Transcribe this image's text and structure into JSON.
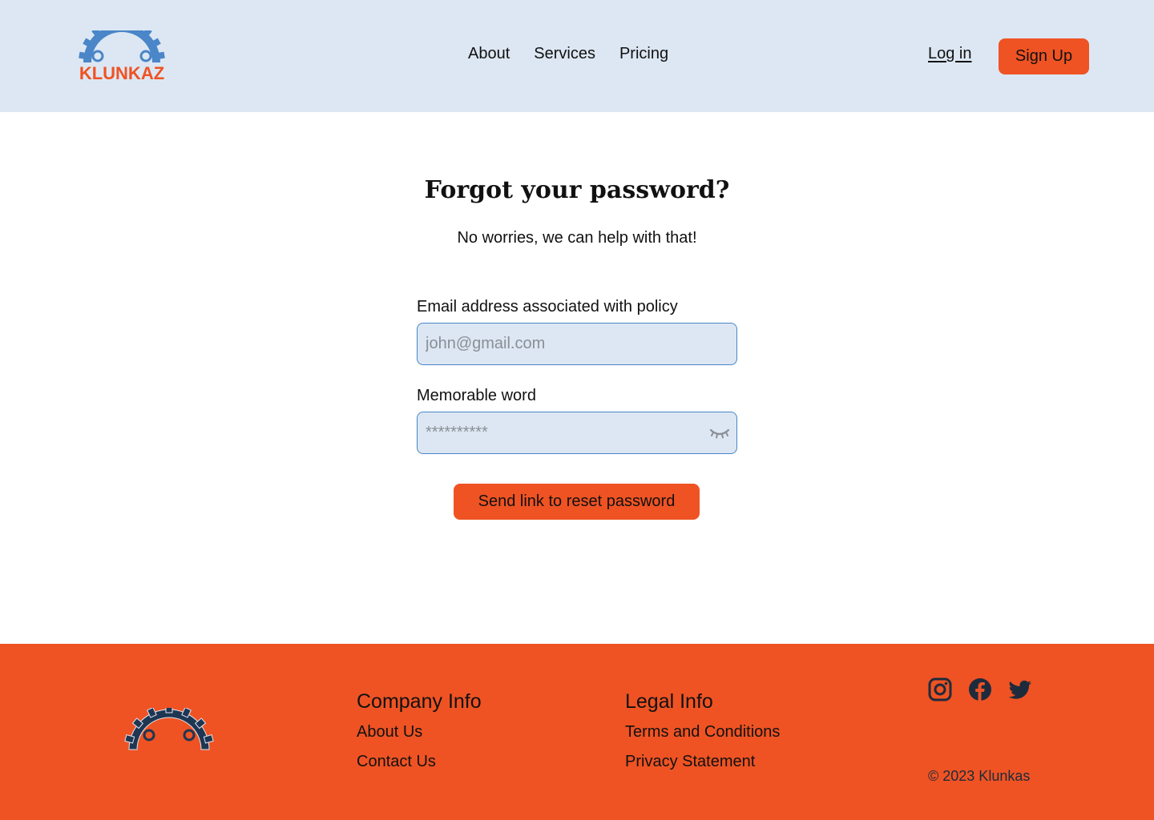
{
  "brand": {
    "logo_text": "KLUNKAZ",
    "accent_color": "#ef5323",
    "logo_gear_color": "#4a86c8",
    "header_bg": "#dce7f3"
  },
  "header": {
    "nav": [
      {
        "label": "About"
      },
      {
        "label": "Services"
      },
      {
        "label": "Pricing"
      }
    ],
    "login_label": "Log in",
    "signup_label": "Sign Up"
  },
  "main": {
    "title": "Forgot your password?",
    "subtitle": "No worries, we can help with that!",
    "email": {
      "label": "Email address associated with policy",
      "placeholder": "john@gmail.com",
      "value": ""
    },
    "memorable": {
      "label": "Memorable word",
      "placeholder": "**********",
      "value": "",
      "toggle_icon": "eye-closed-icon"
    },
    "submit_label": "Send link to reset password"
  },
  "footer": {
    "company": {
      "heading": "Company Info",
      "links": [
        "About Us",
        "Contact Us"
      ]
    },
    "legal": {
      "heading": "Legal Info",
      "links": [
        "Terms and Conditions",
        "Privacy Statement"
      ]
    },
    "social": [
      "instagram-icon",
      "facebook-icon",
      "twitter-icon"
    ],
    "copyright": "© 2023 Klunkas"
  }
}
